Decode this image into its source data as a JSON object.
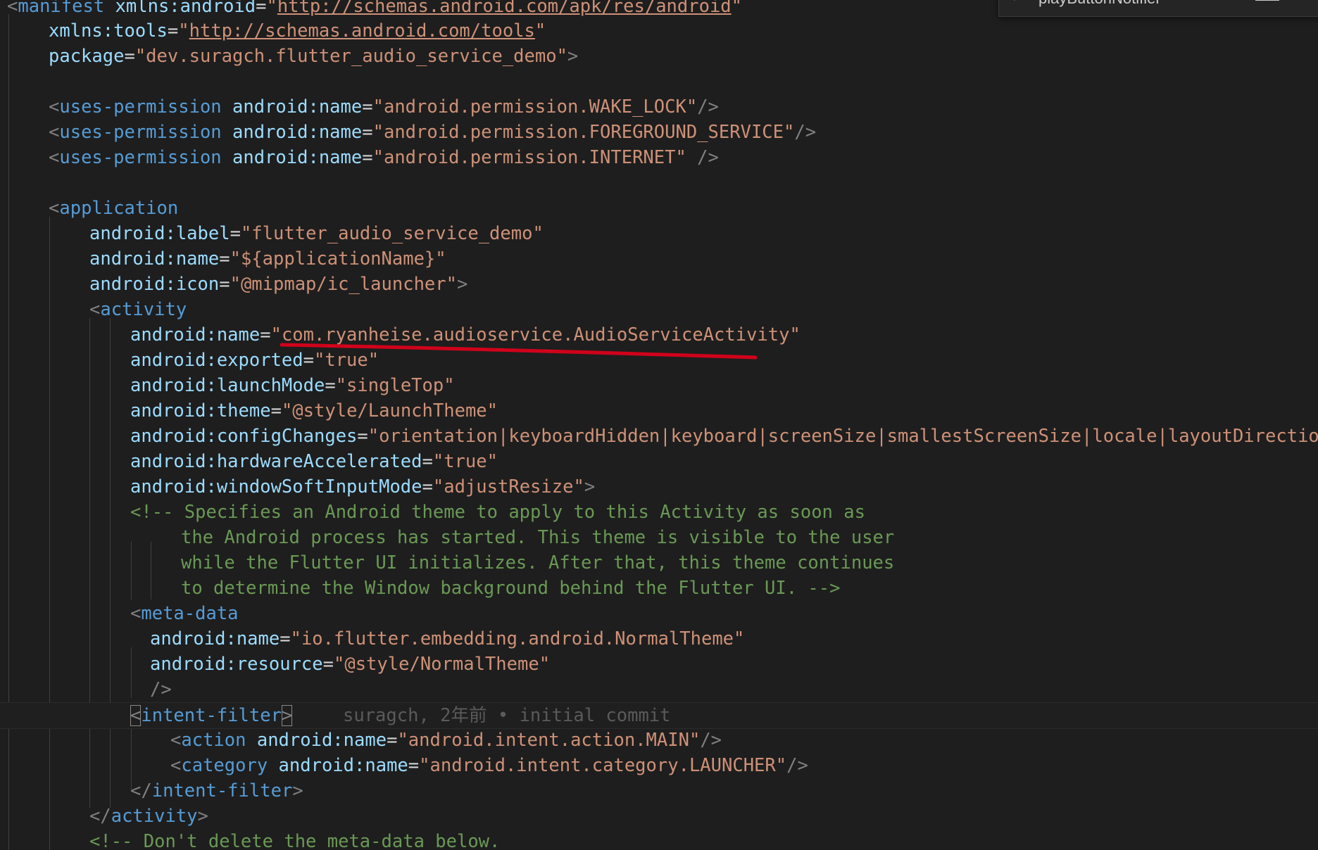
{
  "find_widget": {
    "query": "playButtonNotifier"
  },
  "blame": {
    "text": "suragch, 2年前 • initial commit"
  },
  "code": {
    "l1": {
      "lt": "<",
      "tag": "manifest",
      "attr": "xmlns:android",
      "eq": "=",
      "q1": "\"",
      "url": "http://schemas.android.com/apk/res/android",
      "q2": "\""
    },
    "l2": {
      "attr": "xmlns:tools",
      "eq": "=",
      "q1": "\"",
      "url": "http://schemas.android.com/tools",
      "q2": "\""
    },
    "l3": {
      "attr": "package",
      "eq": "=",
      "val": "\"dev.suragch.flutter_audio_service_demo\"",
      "end": ">"
    },
    "l5": {
      "lt": "<",
      "tag": "uses-permission",
      "attr": "android:name",
      "eq": "=",
      "val": "\"android.permission.WAKE_LOCK\"",
      "end": "/>"
    },
    "l6": {
      "lt": "<",
      "tag": "uses-permission",
      "attr": "android:name",
      "eq": "=",
      "val": "\"android.permission.FOREGROUND_SERVICE\"",
      "end": "/>"
    },
    "l7": {
      "lt": "<",
      "tag": "uses-permission",
      "attr": "android:name",
      "eq": "=",
      "val": "\"android.permission.INTERNET\"",
      "end": " />"
    },
    "l9": {
      "lt": "<",
      "tag": "application"
    },
    "l10": {
      "attr": "android:label",
      "eq": "=",
      "val": "\"flutter_audio_service_demo\""
    },
    "l11": {
      "attr": "android:name",
      "eq": "=",
      "val": "\"${applicationName}\""
    },
    "l12": {
      "attr": "android:icon",
      "eq": "=",
      "val": "\"@mipmap/ic_launcher\"",
      "end": ">"
    },
    "l13": {
      "lt": "<",
      "tag": "activity"
    },
    "l14": {
      "attr": "android:name",
      "eq": "=",
      "val": "\"com.ryanheise.audioservice.AudioServiceActivity\""
    },
    "l15": {
      "attr": "android:exported",
      "eq": "=",
      "val": "\"true\""
    },
    "l16": {
      "attr": "android:launchMode",
      "eq": "=",
      "val": "\"singleTop\""
    },
    "l17": {
      "attr": "android:theme",
      "eq": "=",
      "val": "\"@style/LaunchTheme\""
    },
    "l18": {
      "attr": "android:configChanges",
      "eq": "=",
      "val": "\"orientation|keyboardHidden|keyboard|screenSize|smallestScreenSize|locale|layoutDirection|fontS"
    },
    "l19": {
      "attr": "android:hardwareAccelerated",
      "eq": "=",
      "val": "\"true\""
    },
    "l20": {
      "attr": "android:windowSoftInputMode",
      "eq": "=",
      "val": "\"adjustResize\"",
      "end": ">"
    },
    "l21": {
      "text": "<!-- Specifies an Android theme to apply to this Activity as soon as"
    },
    "l22": {
      "text": "the Android process has started. This theme is visible to the user"
    },
    "l23": {
      "text": "while the Flutter UI initializes. After that, this theme continues"
    },
    "l24": {
      "text": "to determine the Window background behind the Flutter UI. -->"
    },
    "l25": {
      "lt": "<",
      "tag": "meta-data"
    },
    "l26": {
      "attr": "android:name",
      "eq": "=",
      "val": "\"io.flutter.embedding.android.NormalTheme\""
    },
    "l27": {
      "attr": "android:resource",
      "eq": "=",
      "val": "\"@style/NormalTheme\""
    },
    "l28": {
      "end": "/>"
    },
    "l29": {
      "lt": "<",
      "tag": "intent-filter",
      "gt": ">"
    },
    "l30": {
      "lt": "<",
      "tag": "action",
      "attr": "android:name",
      "eq": "=",
      "val": "\"android.intent.action.MAIN\"",
      "end": "/>"
    },
    "l31": {
      "lt": "<",
      "tag": "category",
      "attr": "android:name",
      "eq": "=",
      "val": "\"android.intent.category.LAUNCHER\"",
      "end": "/>"
    },
    "l32": {
      "lt": "</",
      "tag": "intent-filter",
      "gt": ">"
    },
    "l33": {
      "lt": "</",
      "tag": "activity",
      "gt": ">"
    },
    "l34": {
      "text": "<!-- Don't delete the meta-data below."
    }
  },
  "colors": {
    "background": "#1e1e1e",
    "tag": "#569cd6",
    "attribute": "#9cdcfe",
    "string": "#ce9178",
    "comment": "#6a9955",
    "punctuation": "#808080",
    "annotation_red": "#d0021b"
  }
}
